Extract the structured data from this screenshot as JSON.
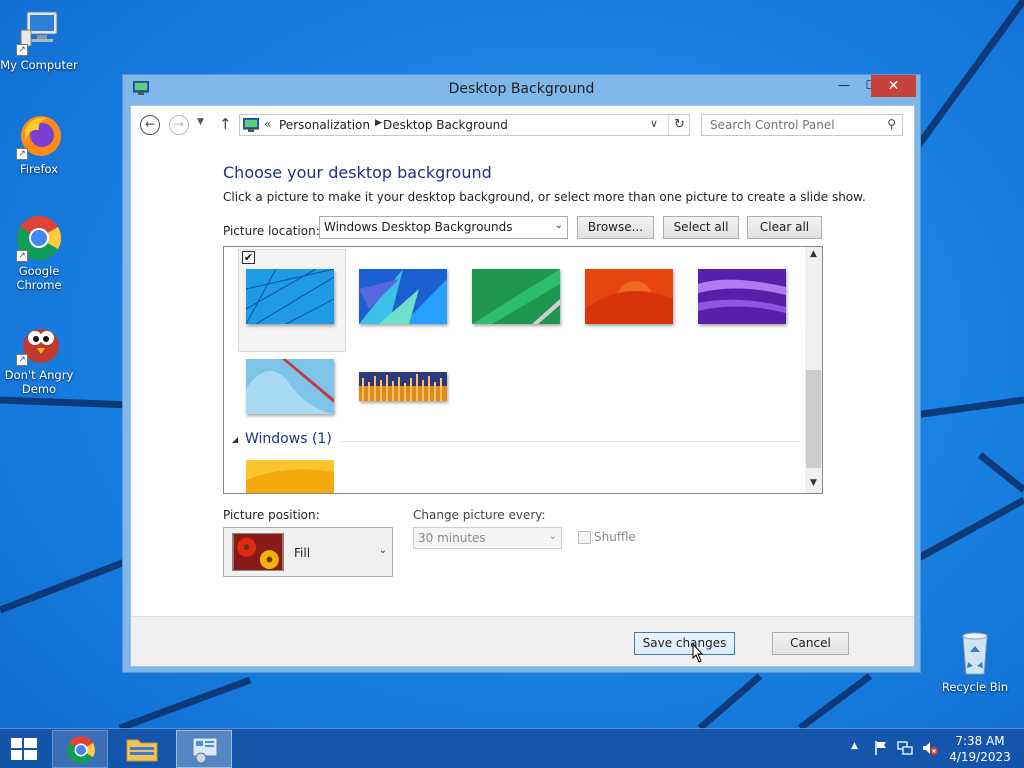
{
  "desktop": {
    "icons": [
      {
        "label": "My Computer"
      },
      {
        "label": "Firefox"
      },
      {
        "label": "Google Chrome"
      },
      {
        "label": "Don't Angry Demo"
      },
      {
        "label": "Recycle Bin"
      }
    ]
  },
  "window": {
    "title": "Desktop Background",
    "address": {
      "chevron": "«",
      "crumbs": [
        "Personalization",
        "Desktop Background"
      ]
    },
    "search": {
      "placeholder": "Search Control Panel"
    },
    "heading": "Choose your desktop background",
    "subtext": "Click a picture to make it your desktop background, or select more than one picture to create a slide show.",
    "picture_location": {
      "label": "Picture location:",
      "value": "Windows Desktop Backgrounds"
    },
    "buttons": {
      "browse": "Browse...",
      "select_all": "Select all",
      "clear_all": "Clear all",
      "save": "Save changes",
      "cancel": "Cancel"
    },
    "thumbnails": [
      {
        "name": "blue-lines",
        "selected": true
      },
      {
        "name": "blue-petals",
        "selected": false
      },
      {
        "name": "green-ribbon",
        "selected": false
      },
      {
        "name": "orange-flow",
        "selected": false
      },
      {
        "name": "purple-waves",
        "selected": false
      },
      {
        "name": "light-blue-curve",
        "selected": false
      },
      {
        "name": "city-skyline",
        "selected": false
      }
    ],
    "group": {
      "title": "Windows (1)"
    },
    "group_thumbnails": [
      {
        "name": "yellow-orange"
      }
    ],
    "picture_position": {
      "label": "Picture position:",
      "value": "Fill"
    },
    "change_picture": {
      "label": "Change picture every:",
      "value": "30 minutes"
    },
    "shuffle": {
      "label": "Shuffle",
      "checked": false
    }
  },
  "taskbar": {
    "clock": {
      "time": "7:38 AM",
      "date": "4/19/2023"
    }
  },
  "colors": {
    "accent_heading": "#1e3287",
    "close_button": "#c7413d",
    "desktop_blue": "#1a84e3"
  }
}
